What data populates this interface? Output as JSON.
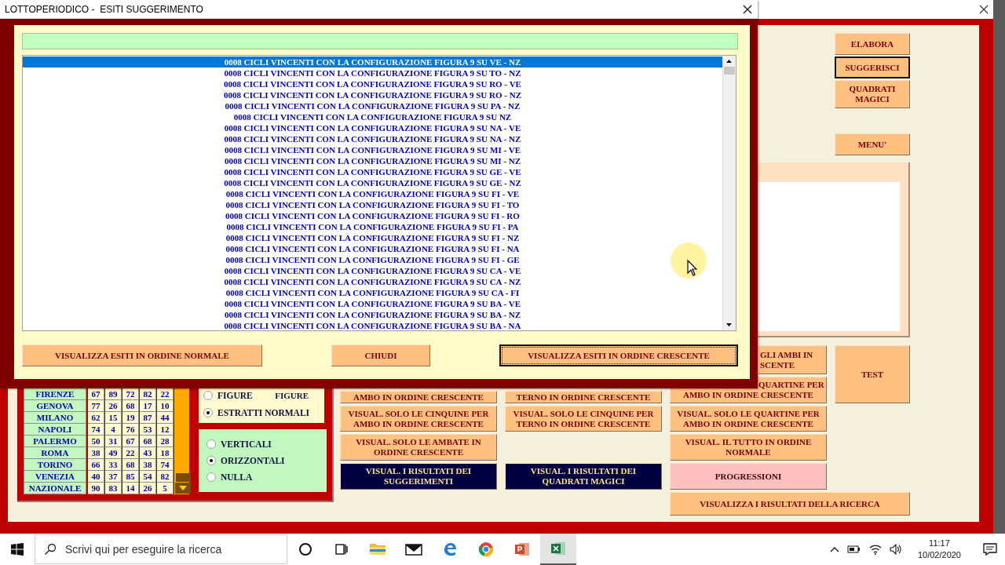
{
  "dialog": {
    "title": "LOTTOPERIODICO -  ESITI SUGGERIMENTO",
    "results": [
      {
        "text": "0008 CICLI VINCENTI CON LA CONFIGURAZIONE FIGURA 9 SU VE - NZ",
        "selected": true
      },
      {
        "text": "0008 CICLI VINCENTI CON LA CONFIGURAZIONE FIGURA 9 SU TO - NZ",
        "selected": false
      },
      {
        "text": "0008 CICLI VINCENTI CON LA CONFIGURAZIONE FIGURA 9 SU RO - VE",
        "selected": false
      },
      {
        "text": "0008 CICLI VINCENTI CON LA CONFIGURAZIONE FIGURA 9 SU RO - NZ",
        "selected": false
      },
      {
        "text": "0008 CICLI VINCENTI CON LA CONFIGURAZIONE FIGURA 9 SU PA - NZ",
        "selected": false
      },
      {
        "text": "0008 CICLI VINCENTI CON LA CONFIGURAZIONE FIGURA 9 SU NZ",
        "selected": false
      },
      {
        "text": "0008 CICLI VINCENTI CON LA CONFIGURAZIONE FIGURA 9 SU NA - VE",
        "selected": false
      },
      {
        "text": "0008 CICLI VINCENTI CON LA CONFIGURAZIONE FIGURA 9 SU NA - NZ",
        "selected": false
      },
      {
        "text": "0008 CICLI VINCENTI CON LA CONFIGURAZIONE FIGURA 9 SU MI - VE",
        "selected": false
      },
      {
        "text": "0008 CICLI VINCENTI CON LA CONFIGURAZIONE FIGURA 9 SU MI - NZ",
        "selected": false
      },
      {
        "text": "0008 CICLI VINCENTI CON LA CONFIGURAZIONE FIGURA 9 SU GE - VE",
        "selected": false
      },
      {
        "text": "0008 CICLI VINCENTI CON LA CONFIGURAZIONE FIGURA 9 SU GE - NZ",
        "selected": false
      },
      {
        "text": "0008 CICLI VINCENTI CON LA CONFIGURAZIONE FIGURA 9 SU FI - VE",
        "selected": false
      },
      {
        "text": "0008 CICLI VINCENTI CON LA CONFIGURAZIONE FIGURA 9 SU FI - TO",
        "selected": false
      },
      {
        "text": "0008 CICLI VINCENTI CON LA CONFIGURAZIONE FIGURA 9 SU FI - RO",
        "selected": false
      },
      {
        "text": "0008 CICLI VINCENTI CON LA CONFIGURAZIONE FIGURA 9 SU FI - PA",
        "selected": false
      },
      {
        "text": "0008 CICLI VINCENTI CON LA CONFIGURAZIONE FIGURA 9 SU FI - NZ",
        "selected": false
      },
      {
        "text": "0008 CICLI VINCENTI CON LA CONFIGURAZIONE FIGURA 9 SU FI - NA",
        "selected": false
      },
      {
        "text": "0008 CICLI VINCENTI CON LA CONFIGURAZIONE FIGURA 9 SU FI - GE",
        "selected": false
      },
      {
        "text": "0008 CICLI VINCENTI CON LA CONFIGURAZIONE FIGURA 9 SU CA - VE",
        "selected": false
      },
      {
        "text": "0008 CICLI VINCENTI CON LA CONFIGURAZIONE FIGURA 9 SU CA - NZ",
        "selected": false
      },
      {
        "text": "0008 CICLI VINCENTI CON LA CONFIGURAZIONE FIGURA 9 SU CA - FI",
        "selected": false
      },
      {
        "text": "0008 CICLI VINCENTI CON LA CONFIGURAZIONE FIGURA 9 SU BA - VE",
        "selected": false
      },
      {
        "text": "0008 CICLI VINCENTI CON LA CONFIGURAZIONE FIGURA 9 SU BA - NZ",
        "selected": false
      },
      {
        "text": "0008 CICLI VINCENTI CON LA CONFIGURAZIONE FIGURA 9 SU BA - NA",
        "selected": false
      }
    ],
    "buttons": [
      {
        "label": "VISUALIZZA ESITI IN ORDINE NORMALE",
        "focused": false
      },
      {
        "label": "CHIUDI",
        "focused": false
      },
      {
        "label": "VISUALIZZA ESITI IN ORDINE CRESCENTE",
        "focused": true
      }
    ]
  },
  "side_buttons": [
    {
      "label": "ELABORA",
      "focused": false
    },
    {
      "label": "SUGGERISCI",
      "focused": true
    },
    {
      "label": "QUADRATI MAGICI",
      "focused": false
    }
  ],
  "menu_button": "MENU'",
  "draws": [
    {
      "city": "FIRENZE",
      "numbers": [
        "67",
        "89",
        "72",
        "82",
        "22"
      ]
    },
    {
      "city": "GENOVA",
      "numbers": [
        "77",
        "26",
        "68",
        "17",
        "10"
      ]
    },
    {
      "city": "MILANO",
      "numbers": [
        "62",
        "15",
        "19",
        "87",
        "44"
      ]
    },
    {
      "city": "NAPOLI",
      "numbers": [
        "74",
        "4",
        "76",
        "53",
        "12"
      ]
    },
    {
      "city": "PALERMO",
      "numbers": [
        "50",
        "31",
        "67",
        "68",
        "28"
      ]
    },
    {
      "city": "ROMA",
      "numbers": [
        "38",
        "49",
        "22",
        "43",
        "18"
      ]
    },
    {
      "city": "TORINO",
      "numbers": [
        "66",
        "33",
        "68",
        "38",
        "74"
      ]
    },
    {
      "city": "VENEZIA",
      "numbers": [
        "40",
        "37",
        "85",
        "54",
        "82"
      ]
    },
    {
      "city": "NAZIONALE",
      "numbers": [
        "90",
        "83",
        "14",
        "26",
        "5"
      ]
    }
  ],
  "source_options": [
    {
      "label": "FIGURE",
      "selected": false
    },
    {
      "label": "ESTRATTI NORMALI",
      "selected": true
    }
  ],
  "source_caption": "FIGURE",
  "orientation_options": [
    {
      "label": "VERTICALI",
      "selected": false
    },
    {
      "label": "ORIZZONTALI",
      "selected": true
    },
    {
      "label": "NULLA",
      "selected": false
    }
  ],
  "button_columns": [
    [
      {
        "kind": "cut_top",
        "label": "AMBO IN ORDINE CRESCENTE"
      },
      {
        "kind": "plain",
        "label": "VISUAL. SOLO LE CINQUINE PER AMBO IN ORDINE CRESCENTE"
      },
      {
        "kind": "plain",
        "label": "VISUAL. SOLO LE AMBATE IN ORDINE CRESCENTE"
      },
      {
        "kind": "dark",
        "label": "VISUAL. I RISULTATI DEI SUGGERIMENTI"
      }
    ],
    [
      {
        "kind": "cut_top",
        "label": "TERNO IN ORDINE CRESCENTE"
      },
      {
        "kind": "plain",
        "label": "VISUAL. SOLO LE CINQUINE PER TERNO IN ORDINE CRESCENTE"
      },
      {
        "kind": "dark",
        "label": "VISUAL. I RISULTATI DEI QUADRATI MAGICI"
      }
    ],
    [
      {
        "kind": "cut_left",
        "label": "GLI AMBI IN SCENTE"
      },
      {
        "kind": "cut_first_line",
        "lines": [
          "QUARTINE PER",
          "AMBO IN ORDINE CRESCENTE"
        ]
      },
      {
        "kind": "plain",
        "label": "VISUAL. SOLO LE QUARTINE PER AMBO IN ORDINE CRESCENTE"
      },
      {
        "kind": "plain",
        "label": "VISUAL. IL TUTTO IN ORDINE NORMALE"
      },
      {
        "kind": "pink",
        "label": "PROGRESSIONI"
      }
    ]
  ],
  "test_button": "TEST",
  "search_results_button": "VISUALIZZA I RISULTATI DELLA RICERCA",
  "taskbar": {
    "search_placeholder": "Scrivi qui per eseguire la ricerca",
    "apps": [
      {
        "kind": "cortana",
        "selected": false
      },
      {
        "kind": "taskview",
        "selected": false
      },
      {
        "kind": "folder",
        "selected": false
      },
      {
        "kind": "mail",
        "selected": false
      },
      {
        "kind": "edge",
        "selected": false
      },
      {
        "kind": "chrome",
        "selected": false
      },
      {
        "kind": "powerpoint",
        "selected": false
      },
      {
        "kind": "excel",
        "selected": true
      }
    ],
    "time": "11:17",
    "date": "10/02/2020"
  }
}
